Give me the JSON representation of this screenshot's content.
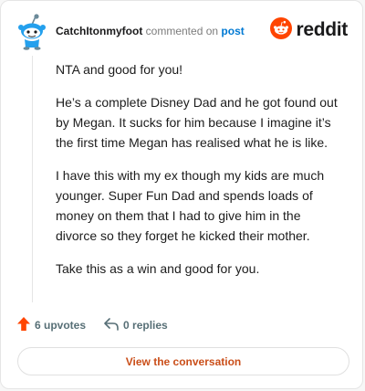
{
  "comment": {
    "username": "CatchItonmyfoot",
    "action": "commented on",
    "post_link": "post",
    "paragraphs": [
      "NTA and good for you!",
      "He’s a complete Disney Dad and he got found out by Megan. It sucks for him because I imagine it’s the first time Megan has realised what he is like.",
      "I have this with my ex though my kids are much younger. Super Fun Dad and spends loads of money on them that I had to give him in the divorce so they forget he kicked their mother.",
      "Take this as a win and good for you."
    ]
  },
  "brand": {
    "wordmark": "reddit",
    "color": "#ff4500"
  },
  "footer": {
    "upvotes": "6 upvotes",
    "replies": "0 replies"
  },
  "cta": {
    "label": "View the conversation",
    "color": "#ca4e19"
  },
  "icons": [
    "snoo-avatar-icon",
    "reddit-logo-icon",
    "upvote-arrow-icon",
    "reply-arrow-icon"
  ]
}
